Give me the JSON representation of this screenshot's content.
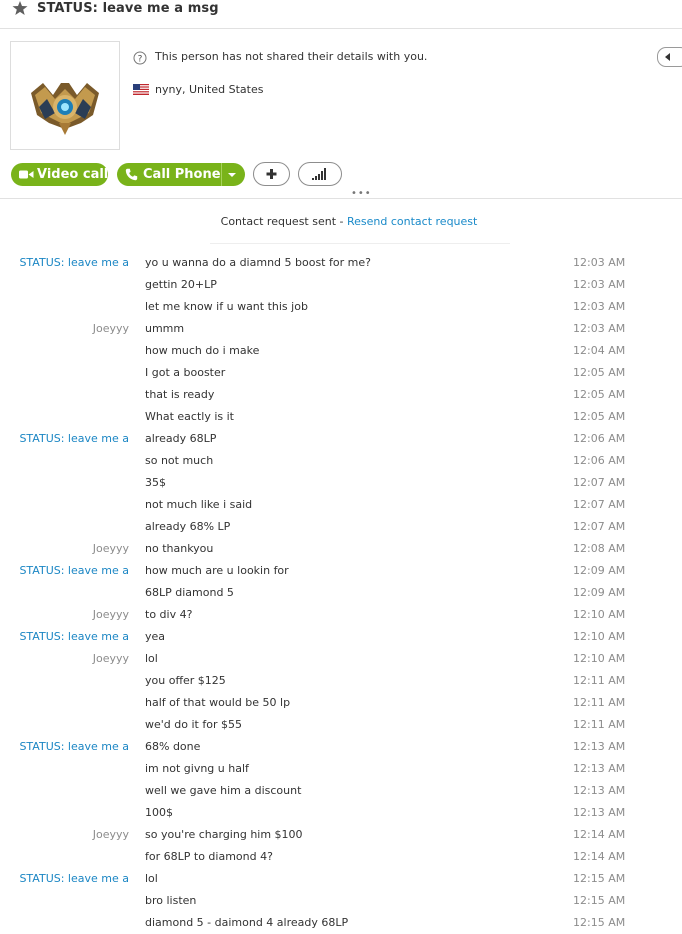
{
  "header": {
    "title": "STATUS:  leave me a msg",
    "star_icon": "star-icon"
  },
  "profile": {
    "details_text": "This person has not shared their details with you.",
    "location": "nyny, United States",
    "avatar": "rank-emblem-avatar"
  },
  "buttons": {
    "video_call": "Video call",
    "call_phone": "Call Phone"
  },
  "notice": {
    "text": "Contact request sent - ",
    "link": "Resend contact request"
  },
  "colors": {
    "accent_green": "#79b31a",
    "link_blue": "#1b86c4"
  },
  "messages": [
    {
      "sender": "STATUS:  leave me a",
      "type": "status",
      "text": "yo u wanna do a diamnd 5 boost for me?",
      "time": "12:03 AM"
    },
    {
      "sender": "",
      "type": "status",
      "text": "gettin 20+LP",
      "time": "12:03 AM"
    },
    {
      "sender": "",
      "type": "status",
      "text": "let me know if u want this job",
      "time": "12:03 AM"
    },
    {
      "sender": "Joeyyy",
      "type": "joey",
      "text": "ummm",
      "time": "12:03 AM"
    },
    {
      "sender": "",
      "type": "joey",
      "text": "how much do i make",
      "time": "12:04 AM"
    },
    {
      "sender": "",
      "type": "joey",
      "text": "I got a booster",
      "time": "12:05 AM"
    },
    {
      "sender": "",
      "type": "joey",
      "text": "that is ready",
      "time": "12:05 AM"
    },
    {
      "sender": "",
      "type": "joey",
      "text": "What eactly is it",
      "time": "12:05 AM"
    },
    {
      "sender": "STATUS:  leave me a",
      "type": "status",
      "text": "already 68LP",
      "time": "12:06 AM"
    },
    {
      "sender": "",
      "type": "status",
      "text": "so not much",
      "time": "12:06 AM"
    },
    {
      "sender": "",
      "type": "status",
      "text": "35$",
      "time": "12:07 AM"
    },
    {
      "sender": "",
      "type": "status",
      "text": "not much like i said",
      "time": "12:07 AM"
    },
    {
      "sender": "",
      "type": "status",
      "text": "already 68% LP",
      "time": "12:07 AM"
    },
    {
      "sender": "Joeyyy",
      "type": "joey",
      "text": "no thankyou",
      "time": "12:08 AM"
    },
    {
      "sender": "STATUS:  leave me a",
      "type": "status",
      "text": "how much are u lookin for",
      "time": "12:09 AM"
    },
    {
      "sender": "",
      "type": "status",
      "text": "68LP diamond 5",
      "time": "12:09 AM"
    },
    {
      "sender": "Joeyyy",
      "type": "joey",
      "text": "to div 4?",
      "time": "12:10 AM"
    },
    {
      "sender": "STATUS:  leave me a",
      "type": "status",
      "text": "yea",
      "time": "12:10 AM"
    },
    {
      "sender": "Joeyyy",
      "type": "joey",
      "text": "lol",
      "time": "12:10 AM"
    },
    {
      "sender": "",
      "type": "joey",
      "text": "you offer $125",
      "time": "12:11 AM"
    },
    {
      "sender": "",
      "type": "joey",
      "text": "half of that would be 50 lp",
      "time": "12:11 AM"
    },
    {
      "sender": "",
      "type": "joey",
      "text": "we'd do it for $55",
      "time": "12:11 AM"
    },
    {
      "sender": "STATUS:  leave me a",
      "type": "status",
      "text": "68% done",
      "time": "12:13 AM"
    },
    {
      "sender": "",
      "type": "status",
      "text": "im not givng u half",
      "time": "12:13 AM"
    },
    {
      "sender": "",
      "type": "status",
      "text": "well we gave him a discount",
      "time": "12:13 AM"
    },
    {
      "sender": "",
      "type": "status",
      "text": "100$",
      "time": "12:13 AM"
    },
    {
      "sender": "Joeyyy",
      "type": "joey",
      "text": "so you're charging him $100",
      "time": "12:14 AM"
    },
    {
      "sender": "",
      "type": "joey",
      "text": "for 68LP to diamond 4?",
      "time": "12:14 AM"
    },
    {
      "sender": "STATUS:  leave me a",
      "type": "status",
      "text": "lol",
      "time": "12:15 AM"
    },
    {
      "sender": "",
      "type": "status",
      "text": "bro listen",
      "time": "12:15 AM"
    },
    {
      "sender": "",
      "type": "status",
      "text": "diamond 5 - daimond 4 already 68LP",
      "time": "12:15 AM"
    }
  ]
}
